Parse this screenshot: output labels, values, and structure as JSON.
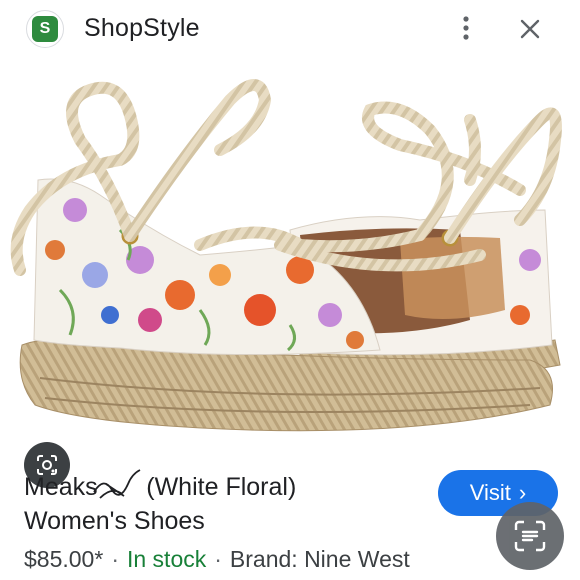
{
  "header": {
    "logo_letter": "S",
    "app_name": "ShopStyle",
    "more_icon": "more-vert-icon",
    "close_icon": "close-icon"
  },
  "image": {
    "lens_icon": "google-lens-icon"
  },
  "product": {
    "title_before": "Meaks",
    "title_after": "(White Floral)",
    "title_line2": "Women's Shoes",
    "price": "$85.00*",
    "separator": "·",
    "stock": "In stock",
    "brand": "Brand: Nine West"
  },
  "actions": {
    "visit_label": "Visit",
    "visit_chevron": "›",
    "scan_icon": "text-scan-icon"
  },
  "colors": {
    "accent": "#1a73e8",
    "stock": "#188038",
    "logo": "#2e8b3e"
  }
}
